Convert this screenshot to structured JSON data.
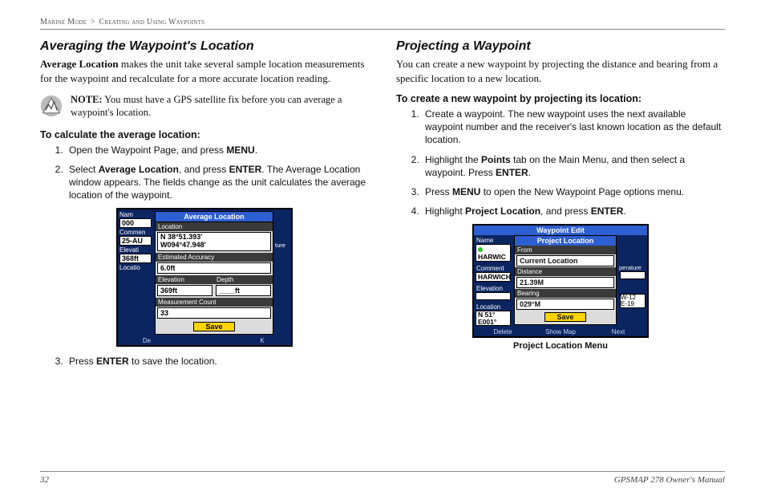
{
  "header": {
    "crumb1": "Marine Mode",
    "gt": ">",
    "crumb2": "Creating and Using Waypoints"
  },
  "left": {
    "h2": "Averaging the Waypoint's Location",
    "lead_pre": "Average Location",
    "lead_rest": " makes the unit take several sample location measurements for the waypoint and recalculate for a more accurate location reading.",
    "note_b": "NOTE:",
    "note_rest": " You must have a GPS satellite fix before you can average a waypoint's location.",
    "steps_title": "To calculate the average location:",
    "s1_a": "Open the Waypoint Page, and press ",
    "s1_b": "MENU",
    "s1_c": ".",
    "s2_a": "Select ",
    "s2_b": "Average Location",
    "s2_c": ", and press ",
    "s2_d": "ENTER",
    "s2_e": ". The Average Location window appears. The fields change as the unit calculates the average location of the waypoint.",
    "s3_a": "Press ",
    "s3_b": "ENTER",
    "s3_c": " to save the location.",
    "screen": {
      "title": "Average Location",
      "lab_name": "Nam",
      "val_name": "000",
      "lab_comment": "Commen",
      "val_comment": "25-AU",
      "lab_elev": "Elevati",
      "val_elev": "368ft",
      "lab_loc": "Locatio",
      "panel_lab_loc": "Location",
      "panel_loc1": "N  38°51.393'",
      "panel_loc2": "W094°47.948'",
      "panel_lab_acc": "Estimated Accuracy",
      "panel_acc": "6.0ft",
      "panel_lab_elev": "Elevation",
      "panel_lab_depth": "Depth",
      "panel_elev": "369ft",
      "panel_depth": "____ft",
      "panel_lab_mc": "Measurement Count",
      "panel_mc": "33",
      "save": "Save",
      "soft_l": "De",
      "soft_r": "K",
      "ture": "ture"
    }
  },
  "right": {
    "h2": "Projecting a Waypoint",
    "lead": "You can create a new waypoint by projecting the distance and bearing from a specific location to a new location.",
    "steps_title": "To create a new waypoint by projecting its location:",
    "s1": "Create a waypoint. The new waypoint uses the next available waypoint number and the receiver's last known location as the default location.",
    "s2_a": "Highlight the ",
    "s2_b": "Points",
    "s2_c": " tab on the Main Menu, and then select a waypoint. Press ",
    "s2_d": "ENTER",
    "s2_e": ".",
    "s3_a": "Press ",
    "s3_b": "MENU",
    "s3_c": " to open the New Waypoint Page options menu.",
    "s4_a": "Highlight ",
    "s4_b": "Project Location",
    "s4_c": ", and press ",
    "s4_d": "ENTER",
    "s4_e": ".",
    "caption": "Project Location Menu",
    "screen": {
      "topbar": "Waypoint Edit",
      "ptitle": "Project Location",
      "lab_name": "Name",
      "val_name": "HARWIC",
      "lab_comment": "Comment",
      "val_comment": "HARWICH",
      "lab_elev": "Elevation",
      "lab_loc": "Location",
      "loc1": "N  51°",
      "loc2": "E001°",
      "plab_from": "From",
      "pval_from": "Current Location",
      "plab_dist": "Distance",
      "pval_dist": "21.39M",
      "plab_bear": "Bearing",
      "pval_bear": "029°M",
      "save": "Save",
      "rlab1": "perature",
      "rlab2": "__°",
      "rloc1": "W-12",
      "rloc2": "E-19",
      "soft1": "Delete",
      "soft2": "Show Map",
      "soft3": "Next"
    }
  },
  "footer": {
    "page": "32",
    "title": "GPSMAP 278 Owner's Manual"
  }
}
